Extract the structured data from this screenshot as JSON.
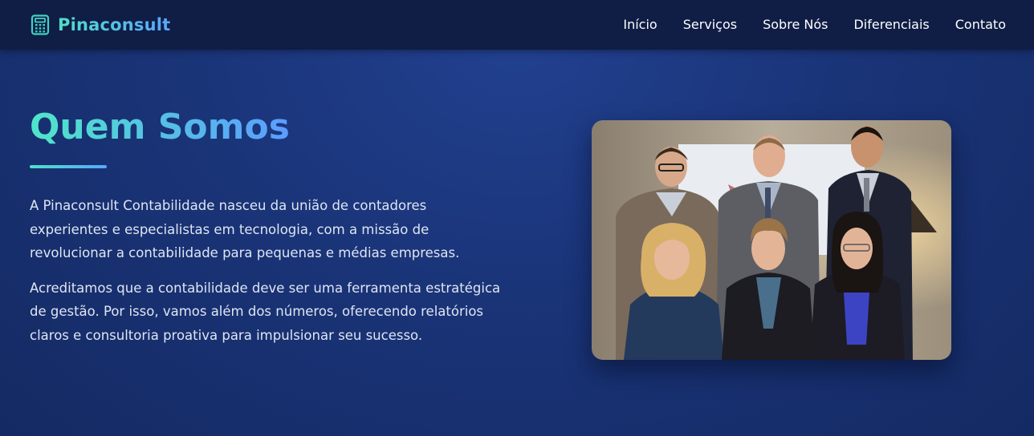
{
  "brand": {
    "name": "Pinaconsult",
    "icon": "calculator-icon"
  },
  "nav": {
    "items": [
      {
        "label": "Início"
      },
      {
        "label": "Serviços"
      },
      {
        "label": "Sobre Nós"
      },
      {
        "label": "Diferenciais"
      },
      {
        "label": "Contato"
      }
    ]
  },
  "about": {
    "title": "Quem Somos",
    "paragraphs": [
      "A Pinaconsult Contabilidade nasceu da união de contadores experientes e especialistas em tecnologia, com a missão de revolucionar a contabilidade para pequenas e médias empresas.",
      "Acreditamos que a contabilidade deve ser uma ferramenta estratégica de gestão. Por isso, vamos além dos números, oferecendo relatórios claros e consultoria proativa para impulsionar seu sucesso."
    ]
  },
  "colors": {
    "navbar_bg": "#101d45",
    "page_bg": "#1a3478",
    "accent_teal": "#4fe0c8",
    "accent_blue": "#5aa6ff",
    "text": "#dfe5f3"
  }
}
